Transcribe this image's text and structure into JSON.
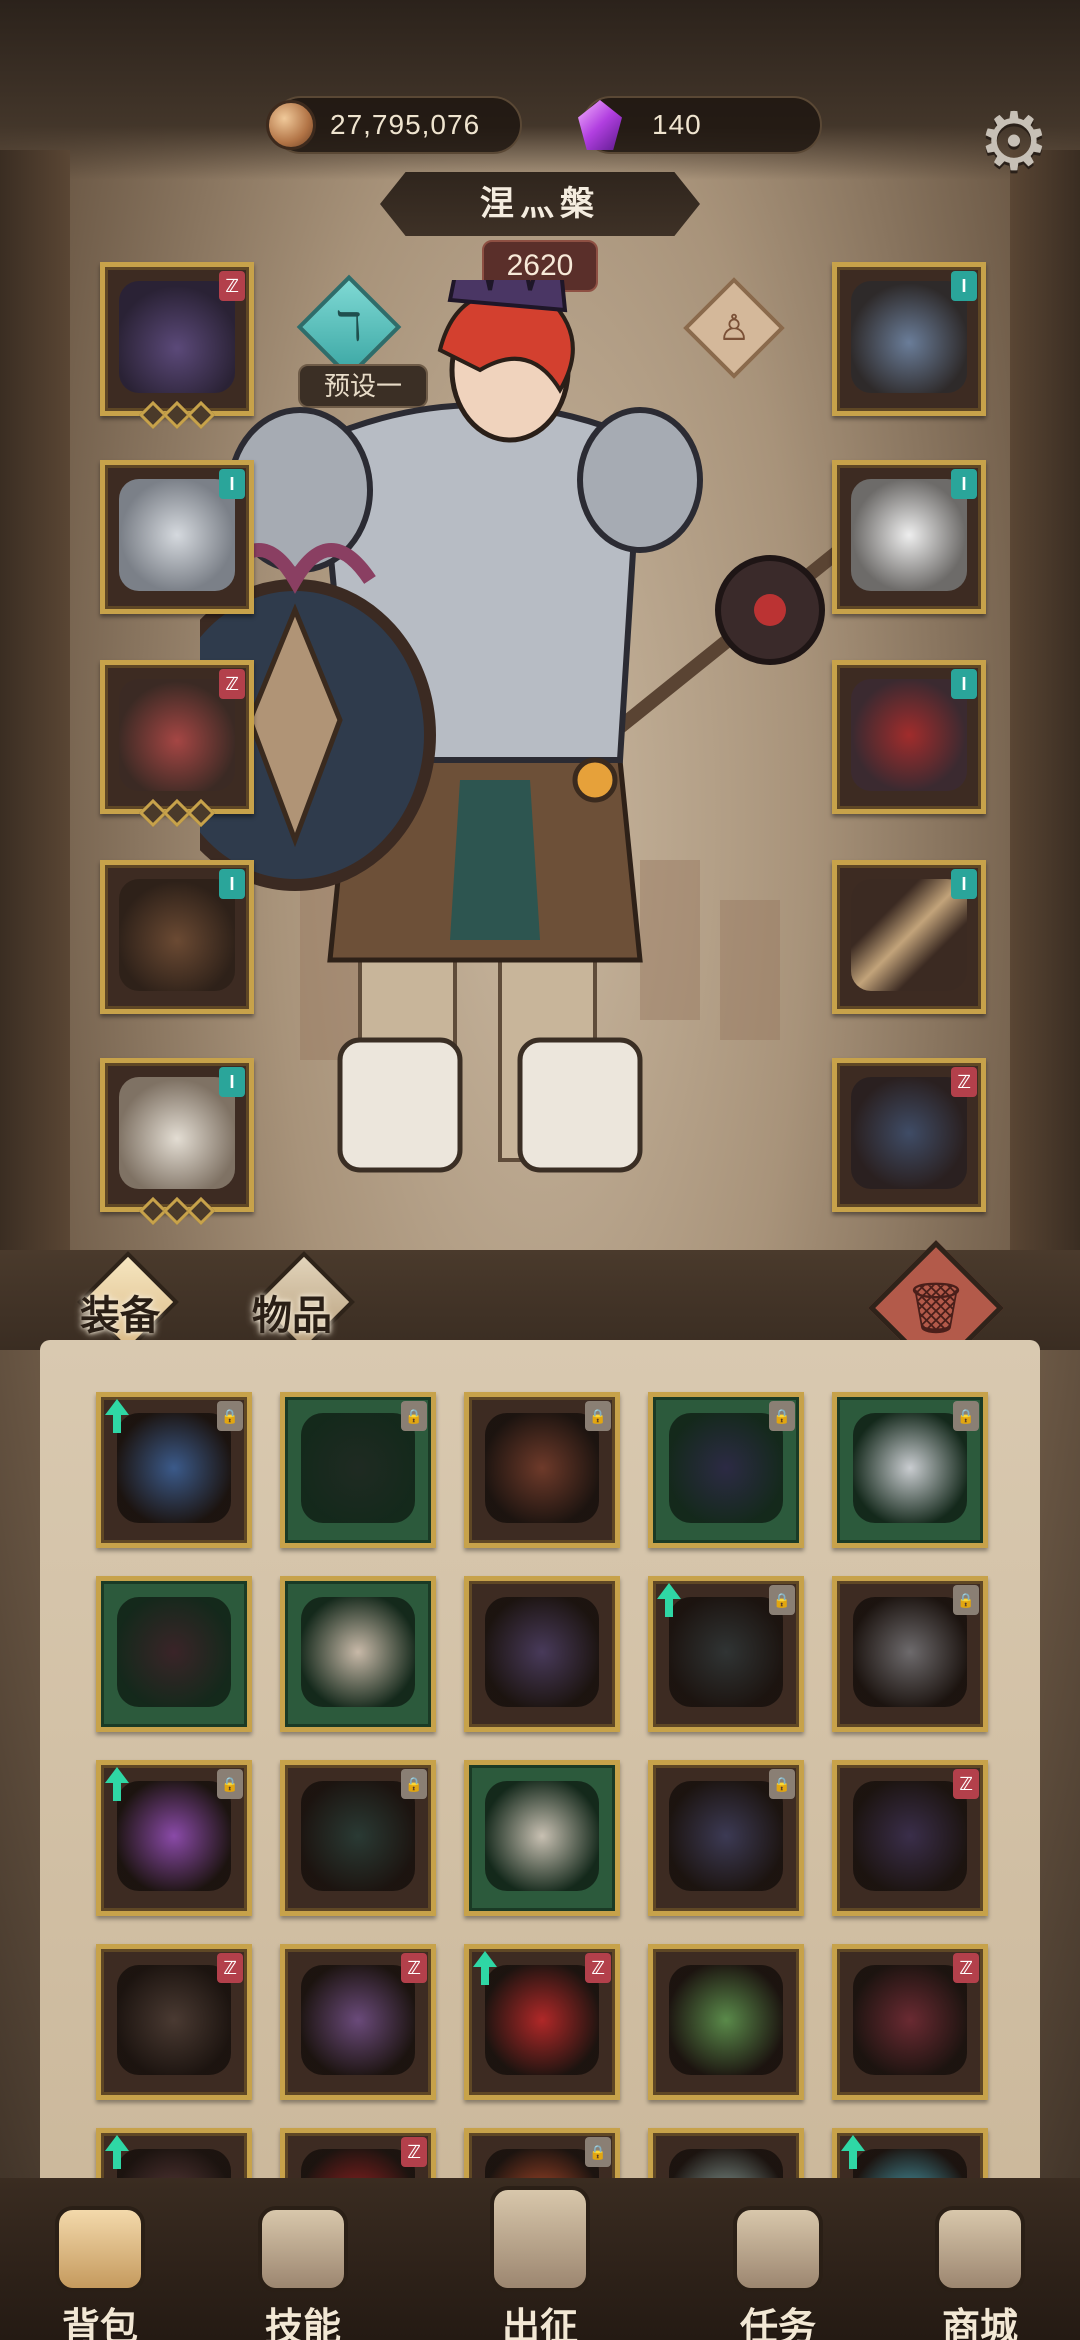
{
  "currency": {
    "gold": "27,795,076",
    "gems": "140",
    "gold_icon": "coin-icon",
    "gem_icon": "crystal-icon"
  },
  "hero": {
    "name": "涅灬槃",
    "power": "2620",
    "preset_label": "预设一"
  },
  "equipment_left": [
    {
      "name": "crown",
      "badge": "",
      "badge_color": "#b3404b",
      "pips": 3
    },
    {
      "name": "chest-armor",
      "badge": "",
      "badge_color": "#2aa59a",
      "pips": 0
    },
    {
      "name": "gauntlet",
      "badge": "",
      "badge_color": "#b3404b",
      "pips": 3
    },
    {
      "name": "leg-armor",
      "badge": "",
      "badge_color": "#2aa59a",
      "pips": 0
    },
    {
      "name": "boots",
      "badge": "",
      "badge_color": "#2aa59a",
      "pips": 3
    }
  ],
  "equipment_right": [
    {
      "name": "amulet",
      "badge": "",
      "badge_color": "#2aa59a",
      "pips": 0
    },
    {
      "name": "pauldron",
      "badge": "",
      "badge_color": "#2aa59a",
      "pips": 0
    },
    {
      "name": "bracer",
      "badge": "",
      "badge_color": "#2aa59a",
      "pips": 0
    },
    {
      "name": "weapon",
      "badge": "",
      "badge_color": "#2aa59a",
      "pips": 0
    },
    {
      "name": "shield",
      "badge": "",
      "badge_color": "#b3404b",
      "pips": 0
    }
  ],
  "tabs": {
    "equipment": "装备",
    "items": "物品"
  },
  "inventory": [
    {
      "name": "robe",
      "green": false,
      "upgrade": true,
      "badge": "grey"
    },
    {
      "name": "wolf-helm",
      "green": true,
      "upgrade": false,
      "badge": "grey"
    },
    {
      "name": "sack-hood",
      "green": false,
      "upgrade": false,
      "badge": "grey"
    },
    {
      "name": "dark-greaves",
      "green": true,
      "upgrade": false,
      "badge": "grey"
    },
    {
      "name": "plate-armor",
      "green": true,
      "upgrade": false,
      "badge": "grey"
    },
    {
      "name": "demon-cuirass",
      "green": true,
      "upgrade": false,
      "badge": ""
    },
    {
      "name": "royal-armor",
      "green": true,
      "upgrade": false,
      "badge": ""
    },
    {
      "name": "bone-glove",
      "green": false,
      "upgrade": false,
      "badge": ""
    },
    {
      "name": "chain-whip",
      "green": false,
      "upgrade": true,
      "badge": "grey"
    },
    {
      "name": "iron-ring",
      "green": false,
      "upgrade": false,
      "badge": "grey"
    },
    {
      "name": "crystal-blade",
      "green": false,
      "upgrade": true,
      "badge": "grey"
    },
    {
      "name": "thorn-cuirass",
      "green": false,
      "upgrade": false,
      "badge": "grey"
    },
    {
      "name": "holy-bracer",
      "green": true,
      "upgrade": false,
      "badge": ""
    },
    {
      "name": "horned-shield",
      "green": false,
      "upgrade": false,
      "badge": "grey"
    },
    {
      "name": "eye-armor",
      "green": false,
      "upgrade": false,
      "badge": "red"
    },
    {
      "name": "leather-skirt",
      "green": false,
      "upgrade": false,
      "badge": "red"
    },
    {
      "name": "skull-gauntlet",
      "green": false,
      "upgrade": false,
      "badge": "red"
    },
    {
      "name": "red-helm",
      "green": false,
      "upgrade": true,
      "badge": "red"
    },
    {
      "name": "poison-amulet",
      "green": false,
      "upgrade": false,
      "badge": ""
    },
    {
      "name": "spiked-club",
      "green": false,
      "upgrade": false,
      "badge": "red"
    },
    {
      "name": "spike-helm",
      "green": false,
      "upgrade": true,
      "badge": ""
    },
    {
      "name": "red-boots",
      "green": false,
      "upgrade": false,
      "badge": "red"
    },
    {
      "name": "flame-gloves",
      "green": false,
      "upgrade": false,
      "badge": "grey"
    },
    {
      "name": "jade-crown",
      "green": false,
      "upgrade": false,
      "badge": ""
    },
    {
      "name": "charm-necklace",
      "green": false,
      "upgrade": true,
      "badge": ""
    }
  ],
  "nav": [
    {
      "label": "背包",
      "icon": "backpack-icon",
      "active": true
    },
    {
      "label": "技能",
      "icon": "skill-icon",
      "active": false
    },
    {
      "label": "出征",
      "icon": "expedition-icon",
      "active": false
    },
    {
      "label": "任务",
      "icon": "quest-icon",
      "active": false
    },
    {
      "label": "商城",
      "icon": "shop-icon",
      "active": false
    }
  ],
  "colors": {
    "gold": "#c7a24a",
    "teal": "#2aa59a",
    "red": "#b3404b",
    "green_slot": "#2c5a3c",
    "upgrade": "#2fd7a5"
  }
}
